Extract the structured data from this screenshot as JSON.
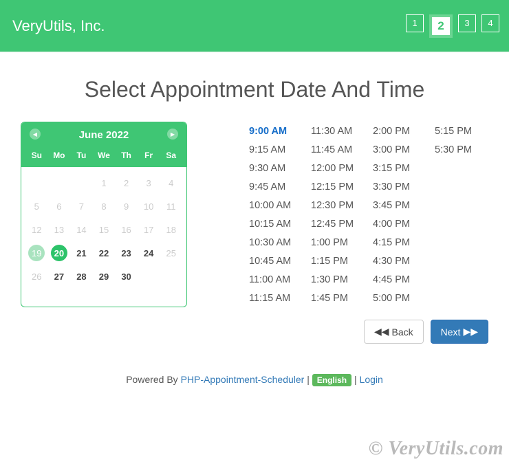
{
  "header": {
    "brand": "VeryUtils, Inc.",
    "steps": [
      "1",
      "2",
      "3",
      "4"
    ],
    "active_step": "2"
  },
  "page_title": "Select Appointment Date And Time",
  "calendar": {
    "month_label": "June 2022",
    "dow": [
      "Su",
      "Mo",
      "Tu",
      "We",
      "Th",
      "Fr",
      "Sa"
    ],
    "weeks": [
      [
        {
          "n": "",
          "state": "empty"
        },
        {
          "n": "",
          "state": "empty"
        },
        {
          "n": "",
          "state": "empty"
        },
        {
          "n": "1",
          "state": "disabled"
        },
        {
          "n": "2",
          "state": "disabled"
        },
        {
          "n": "3",
          "state": "disabled"
        },
        {
          "n": "4",
          "state": "disabled"
        }
      ],
      [
        {
          "n": "5",
          "state": "disabled"
        },
        {
          "n": "6",
          "state": "disabled"
        },
        {
          "n": "7",
          "state": "disabled"
        },
        {
          "n": "8",
          "state": "disabled"
        },
        {
          "n": "9",
          "state": "disabled"
        },
        {
          "n": "10",
          "state": "disabled"
        },
        {
          "n": "11",
          "state": "disabled"
        }
      ],
      [
        {
          "n": "12",
          "state": "disabled"
        },
        {
          "n": "13",
          "state": "disabled"
        },
        {
          "n": "14",
          "state": "disabled"
        },
        {
          "n": "15",
          "state": "disabled"
        },
        {
          "n": "16",
          "state": "disabled"
        },
        {
          "n": "17",
          "state": "disabled"
        },
        {
          "n": "18",
          "state": "disabled"
        }
      ],
      [
        {
          "n": "19",
          "state": "today"
        },
        {
          "n": "20",
          "state": "selected"
        },
        {
          "n": "21",
          "state": "bold"
        },
        {
          "n": "22",
          "state": "bold"
        },
        {
          "n": "23",
          "state": "bold"
        },
        {
          "n": "24",
          "state": "bold"
        },
        {
          "n": "25",
          "state": "disabled"
        }
      ],
      [
        {
          "n": "26",
          "state": "disabled"
        },
        {
          "n": "27",
          "state": "bold"
        },
        {
          "n": "28",
          "state": "bold"
        },
        {
          "n": "29",
          "state": "bold"
        },
        {
          "n": "30",
          "state": "bold"
        },
        {
          "n": "",
          "state": "empty"
        },
        {
          "n": "",
          "state": "empty"
        }
      ]
    ]
  },
  "timeslots": {
    "selected": "9:00 AM",
    "columns": [
      [
        "9:00 AM",
        "9:15 AM",
        "9:30 AM",
        "9:45 AM",
        "10:00 AM",
        "10:15 AM",
        "10:30 AM",
        "10:45 AM",
        "11:00 AM",
        "11:15 AM"
      ],
      [
        "11:30 AM",
        "11:45 AM",
        "12:00 PM",
        "12:15 PM",
        "12:30 PM",
        "12:45 PM",
        "1:00 PM",
        "1:15 PM",
        "1:30 PM",
        "1:45 PM"
      ],
      [
        "2:00 PM",
        "3:00 PM",
        "3:15 PM",
        "3:30 PM",
        "3:45 PM",
        "4:00 PM",
        "4:15 PM",
        "4:30 PM",
        "4:45 PM",
        "5:00 PM"
      ],
      [
        "5:15 PM",
        "5:30 PM"
      ]
    ]
  },
  "nav": {
    "back_label": "Back",
    "next_label": "Next"
  },
  "footer": {
    "prefix": "Powered By ",
    "product_link": "PHP-Appointment-Scheduler",
    "sep": " | ",
    "lang_label": "English",
    "login_label": "Login"
  },
  "watermark": "© VeryUtils.com"
}
